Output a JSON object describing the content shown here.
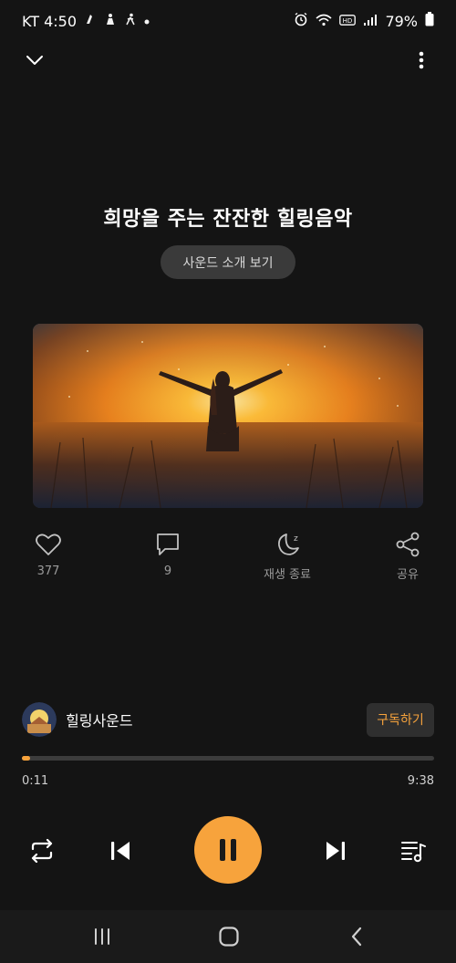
{
  "status": {
    "carrier_time": "KT 4:50",
    "battery": "79%"
  },
  "player": {
    "title": "희망을 주는 잔잔한 힐링음악",
    "intro_button": "사운드 소개 보기",
    "actions": {
      "like_count": "377",
      "comment_count": "9",
      "sleep_label": "재생 종료",
      "share_label": "공유"
    },
    "channel": {
      "name": "힐링사운드",
      "subscribe_label": "구독하기"
    },
    "progress": {
      "current": "0:11",
      "total": "9:38",
      "fraction": 0.019
    }
  },
  "colors": {
    "accent": "#f7a33c",
    "background": "#141414"
  }
}
